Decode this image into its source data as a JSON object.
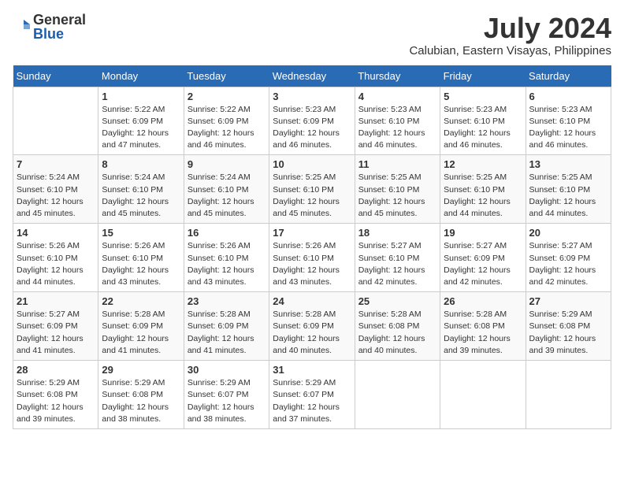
{
  "logo": {
    "general": "General",
    "blue": "Blue"
  },
  "title": "July 2024",
  "subtitle": "Calubian, Eastern Visayas, Philippines",
  "days_header": [
    "Sunday",
    "Monday",
    "Tuesday",
    "Wednesday",
    "Thursday",
    "Friday",
    "Saturday"
  ],
  "weeks": [
    [
      {
        "day": "",
        "info": ""
      },
      {
        "day": "1",
        "info": "Sunrise: 5:22 AM\nSunset: 6:09 PM\nDaylight: 12 hours\nand 47 minutes."
      },
      {
        "day": "2",
        "info": "Sunrise: 5:22 AM\nSunset: 6:09 PM\nDaylight: 12 hours\nand 46 minutes."
      },
      {
        "day": "3",
        "info": "Sunrise: 5:23 AM\nSunset: 6:09 PM\nDaylight: 12 hours\nand 46 minutes."
      },
      {
        "day": "4",
        "info": "Sunrise: 5:23 AM\nSunset: 6:10 PM\nDaylight: 12 hours\nand 46 minutes."
      },
      {
        "day": "5",
        "info": "Sunrise: 5:23 AM\nSunset: 6:10 PM\nDaylight: 12 hours\nand 46 minutes."
      },
      {
        "day": "6",
        "info": "Sunrise: 5:23 AM\nSunset: 6:10 PM\nDaylight: 12 hours\nand 46 minutes."
      }
    ],
    [
      {
        "day": "7",
        "info": "Sunrise: 5:24 AM\nSunset: 6:10 PM\nDaylight: 12 hours\nand 45 minutes."
      },
      {
        "day": "8",
        "info": "Sunrise: 5:24 AM\nSunset: 6:10 PM\nDaylight: 12 hours\nand 45 minutes."
      },
      {
        "day": "9",
        "info": "Sunrise: 5:24 AM\nSunset: 6:10 PM\nDaylight: 12 hours\nand 45 minutes."
      },
      {
        "day": "10",
        "info": "Sunrise: 5:25 AM\nSunset: 6:10 PM\nDaylight: 12 hours\nand 45 minutes."
      },
      {
        "day": "11",
        "info": "Sunrise: 5:25 AM\nSunset: 6:10 PM\nDaylight: 12 hours\nand 45 minutes."
      },
      {
        "day": "12",
        "info": "Sunrise: 5:25 AM\nSunset: 6:10 PM\nDaylight: 12 hours\nand 44 minutes."
      },
      {
        "day": "13",
        "info": "Sunrise: 5:25 AM\nSunset: 6:10 PM\nDaylight: 12 hours\nand 44 minutes."
      }
    ],
    [
      {
        "day": "14",
        "info": "Sunrise: 5:26 AM\nSunset: 6:10 PM\nDaylight: 12 hours\nand 44 minutes."
      },
      {
        "day": "15",
        "info": "Sunrise: 5:26 AM\nSunset: 6:10 PM\nDaylight: 12 hours\nand 43 minutes."
      },
      {
        "day": "16",
        "info": "Sunrise: 5:26 AM\nSunset: 6:10 PM\nDaylight: 12 hours\nand 43 minutes."
      },
      {
        "day": "17",
        "info": "Sunrise: 5:26 AM\nSunset: 6:10 PM\nDaylight: 12 hours\nand 43 minutes."
      },
      {
        "day": "18",
        "info": "Sunrise: 5:27 AM\nSunset: 6:10 PM\nDaylight: 12 hours\nand 42 minutes."
      },
      {
        "day": "19",
        "info": "Sunrise: 5:27 AM\nSunset: 6:09 PM\nDaylight: 12 hours\nand 42 minutes."
      },
      {
        "day": "20",
        "info": "Sunrise: 5:27 AM\nSunset: 6:09 PM\nDaylight: 12 hours\nand 42 minutes."
      }
    ],
    [
      {
        "day": "21",
        "info": "Sunrise: 5:27 AM\nSunset: 6:09 PM\nDaylight: 12 hours\nand 41 minutes."
      },
      {
        "day": "22",
        "info": "Sunrise: 5:28 AM\nSunset: 6:09 PM\nDaylight: 12 hours\nand 41 minutes."
      },
      {
        "day": "23",
        "info": "Sunrise: 5:28 AM\nSunset: 6:09 PM\nDaylight: 12 hours\nand 41 minutes."
      },
      {
        "day": "24",
        "info": "Sunrise: 5:28 AM\nSunset: 6:09 PM\nDaylight: 12 hours\nand 40 minutes."
      },
      {
        "day": "25",
        "info": "Sunrise: 5:28 AM\nSunset: 6:08 PM\nDaylight: 12 hours\nand 40 minutes."
      },
      {
        "day": "26",
        "info": "Sunrise: 5:28 AM\nSunset: 6:08 PM\nDaylight: 12 hours\nand 39 minutes."
      },
      {
        "day": "27",
        "info": "Sunrise: 5:29 AM\nSunset: 6:08 PM\nDaylight: 12 hours\nand 39 minutes."
      }
    ],
    [
      {
        "day": "28",
        "info": "Sunrise: 5:29 AM\nSunset: 6:08 PM\nDaylight: 12 hours\nand 39 minutes."
      },
      {
        "day": "29",
        "info": "Sunrise: 5:29 AM\nSunset: 6:08 PM\nDaylight: 12 hours\nand 38 minutes."
      },
      {
        "day": "30",
        "info": "Sunrise: 5:29 AM\nSunset: 6:07 PM\nDaylight: 12 hours\nand 38 minutes."
      },
      {
        "day": "31",
        "info": "Sunrise: 5:29 AM\nSunset: 6:07 PM\nDaylight: 12 hours\nand 37 minutes."
      },
      {
        "day": "",
        "info": ""
      },
      {
        "day": "",
        "info": ""
      },
      {
        "day": "",
        "info": ""
      }
    ]
  ]
}
